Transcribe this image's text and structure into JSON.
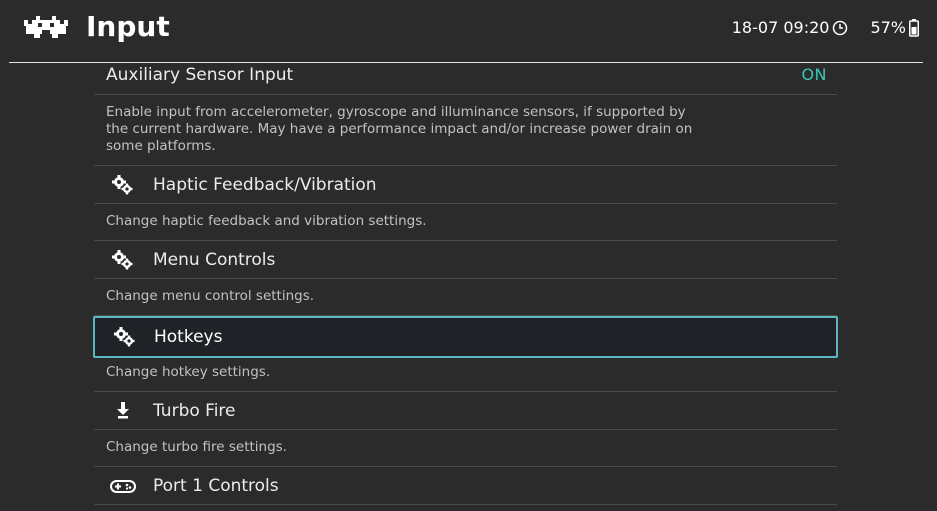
{
  "header": {
    "title": "Input",
    "datetime": "18-07 09:20",
    "battery": "57%",
    "icons": {
      "logo": "retroarch-invader-logo",
      "clock": "clock-icon",
      "battery": "battery-icon"
    }
  },
  "items": [
    {
      "label": "Auxiliary Sensor Input",
      "value": "ON",
      "description": "Enable input from accelerometer, gyroscope and illuminance sensors, if supported by the current hardware. May have a performance impact and/or increase power drain on some platforms."
    },
    {
      "label": "Haptic Feedback/Vibration",
      "icon": "settings-gears-icon",
      "description": "Change haptic feedback and vibration settings."
    },
    {
      "label": "Menu Controls",
      "icon": "settings-gears-icon",
      "description": "Change menu control settings."
    },
    {
      "label": "Hotkeys",
      "icon": "settings-gears-icon",
      "description": "Change hotkey settings.",
      "selected": true
    },
    {
      "label": "Turbo Fire",
      "icon": "turbo-fire-icon",
      "description": "Change turbo fire settings."
    },
    {
      "label": "Port 1 Controls",
      "icon": "gamepad-icon"
    }
  ],
  "colors": {
    "background": "#2b2b2b",
    "accent": "#35c7b4",
    "selection_border": "#5bb8c0"
  }
}
